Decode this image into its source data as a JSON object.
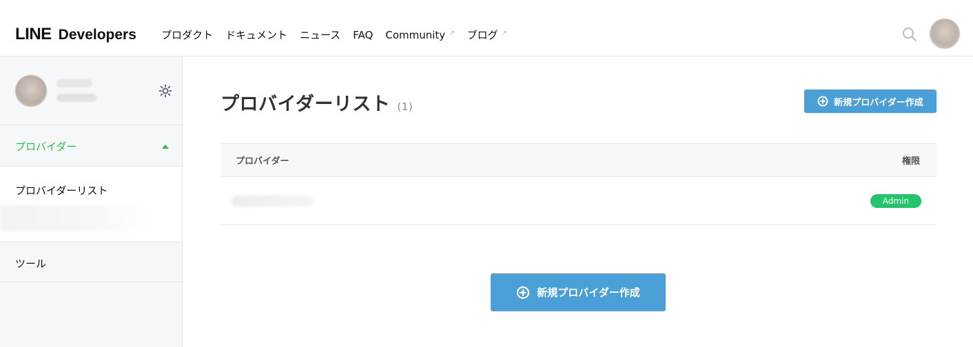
{
  "header": {
    "logo_line": "LINE",
    "logo_developers": "Developers",
    "nav": [
      {
        "label": "プロダクト",
        "external": false
      },
      {
        "label": "ドキュメント",
        "external": false
      },
      {
        "label": "ニュース",
        "external": false
      },
      {
        "label": "FAQ",
        "external": false
      },
      {
        "label": "Community",
        "external": true
      },
      {
        "label": "ブログ",
        "external": true
      }
    ],
    "external_link_icon": "↗",
    "search_icon": "search-icon",
    "avatar_icon": "avatar"
  },
  "sidebar": {
    "settings_icon": "gear-icon",
    "section": {
      "label": "プロバイダー",
      "items": [
        {
          "label": "プロバイダーリスト"
        }
      ]
    },
    "tools_label": "ツール"
  },
  "main": {
    "title": "プロバイダーリスト",
    "count": "(1)",
    "create_button_top": "新規プロバイダー作成",
    "table": {
      "headers": [
        "プロバイダー",
        "権限"
      ],
      "rows": [
        {
          "permission": "Admin"
        }
      ]
    },
    "create_button_center": "新規プロバイダー作成"
  },
  "colors": {
    "brand_green": "#2dbb4d",
    "badge_green": "#25c36b",
    "button_blue": "#4a9fd6"
  }
}
